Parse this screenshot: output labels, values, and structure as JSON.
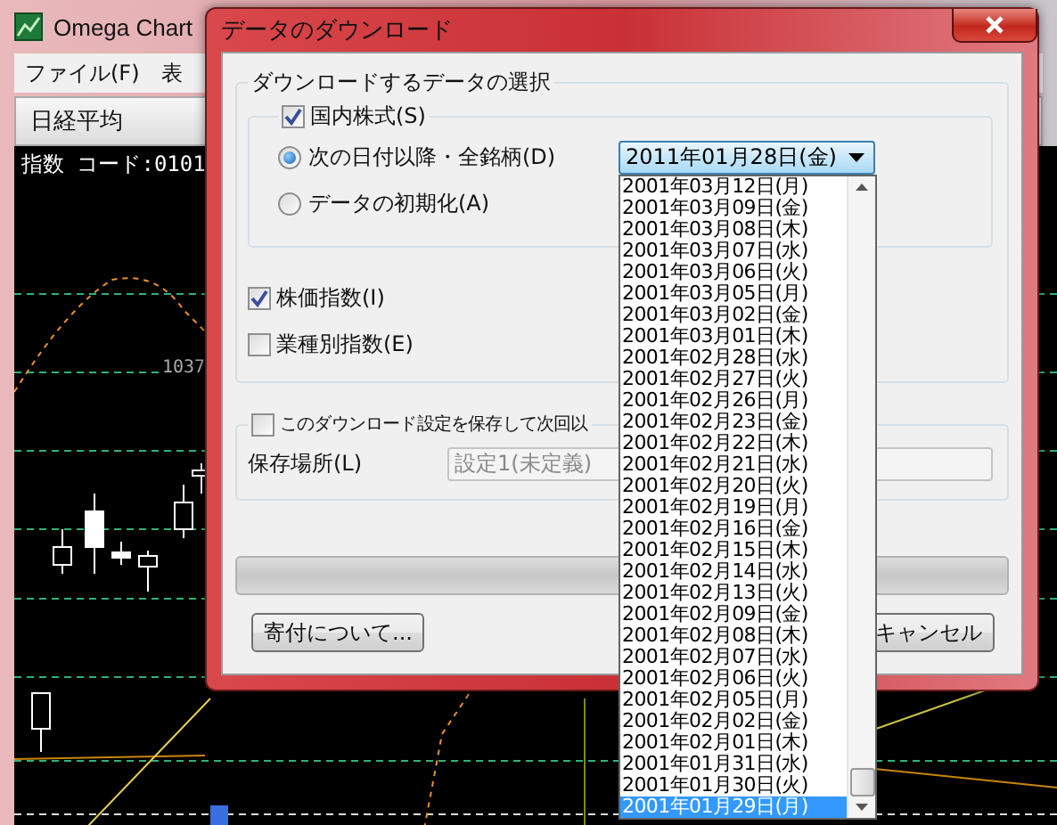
{
  "main_window": {
    "title": "Omega Chart",
    "menu": [
      "ファイル(F)",
      "表"
    ],
    "tab": "日経平均",
    "chart": {
      "header": "指数 コード:0101",
      "value_label": "1037"
    }
  },
  "dialog": {
    "title": "データのダウンロード",
    "data_group": {
      "title": "ダウンロードするデータの選択",
      "domestic": {
        "label": "国内株式(S)",
        "checked": true
      },
      "options": [
        {
          "label": "次の日付以降・全銘柄(D)",
          "selected": true
        },
        {
          "label": "データの初期化(A)",
          "selected": false
        }
      ],
      "date_select": {
        "value": "2011年01月28日(金)",
        "expanded": true,
        "items": [
          {
            "label": "2001年03月12日(月)",
            "selected": false
          },
          {
            "label": "2001年03月09日(金)",
            "selected": false
          },
          {
            "label": "2001年03月08日(木)",
            "selected": false
          },
          {
            "label": "2001年03月07日(水)",
            "selected": false
          },
          {
            "label": "2001年03月06日(火)",
            "selected": false
          },
          {
            "label": "2001年03月05日(月)",
            "selected": false
          },
          {
            "label": "2001年03月02日(金)",
            "selected": false
          },
          {
            "label": "2001年03月01日(木)",
            "selected": false
          },
          {
            "label": "2001年02月28日(水)",
            "selected": false
          },
          {
            "label": "2001年02月27日(火)",
            "selected": false
          },
          {
            "label": "2001年02月26日(月)",
            "selected": false
          },
          {
            "label": "2001年02月23日(金)",
            "selected": false
          },
          {
            "label": "2001年02月22日(木)",
            "selected": false
          },
          {
            "label": "2001年02月21日(水)",
            "selected": false
          },
          {
            "label": "2001年02月20日(火)",
            "selected": false
          },
          {
            "label": "2001年02月19日(月)",
            "selected": false
          },
          {
            "label": "2001年02月16日(金)",
            "selected": false
          },
          {
            "label": "2001年02月15日(木)",
            "selected": false
          },
          {
            "label": "2001年02月14日(水)",
            "selected": false
          },
          {
            "label": "2001年02月13日(火)",
            "selected": false
          },
          {
            "label": "2001年02月09日(金)",
            "selected": false
          },
          {
            "label": "2001年02月08日(木)",
            "selected": false
          },
          {
            "label": "2001年02月07日(水)",
            "selected": false
          },
          {
            "label": "2001年02月06日(火)",
            "selected": false
          },
          {
            "label": "2001年02月05日(月)",
            "selected": false
          },
          {
            "label": "2001年02月02日(金)",
            "selected": false
          },
          {
            "label": "2001年02月01日(木)",
            "selected": false
          },
          {
            "label": "2001年01月31日(水)",
            "selected": false
          },
          {
            "label": "2001年01月30日(火)",
            "selected": false
          },
          {
            "label": "2001年01月29日(月)",
            "selected": true
          }
        ]
      },
      "checks": [
        {
          "label": "株価指数(I)",
          "checked": true
        },
        {
          "label": "業種別指数(E)",
          "checked": false
        }
      ]
    },
    "save_group": {
      "checkbox": {
        "label": "このダウンロード設定を保存して次回以",
        "checked": false
      },
      "location_label": "保存場所(L)",
      "location_value": "設定1(未定義)"
    },
    "progress": {
      "level": 0
    },
    "buttons": [
      {
        "label": "寄付について..."
      },
      {
        "label": "キャンセル"
      }
    ]
  }
}
